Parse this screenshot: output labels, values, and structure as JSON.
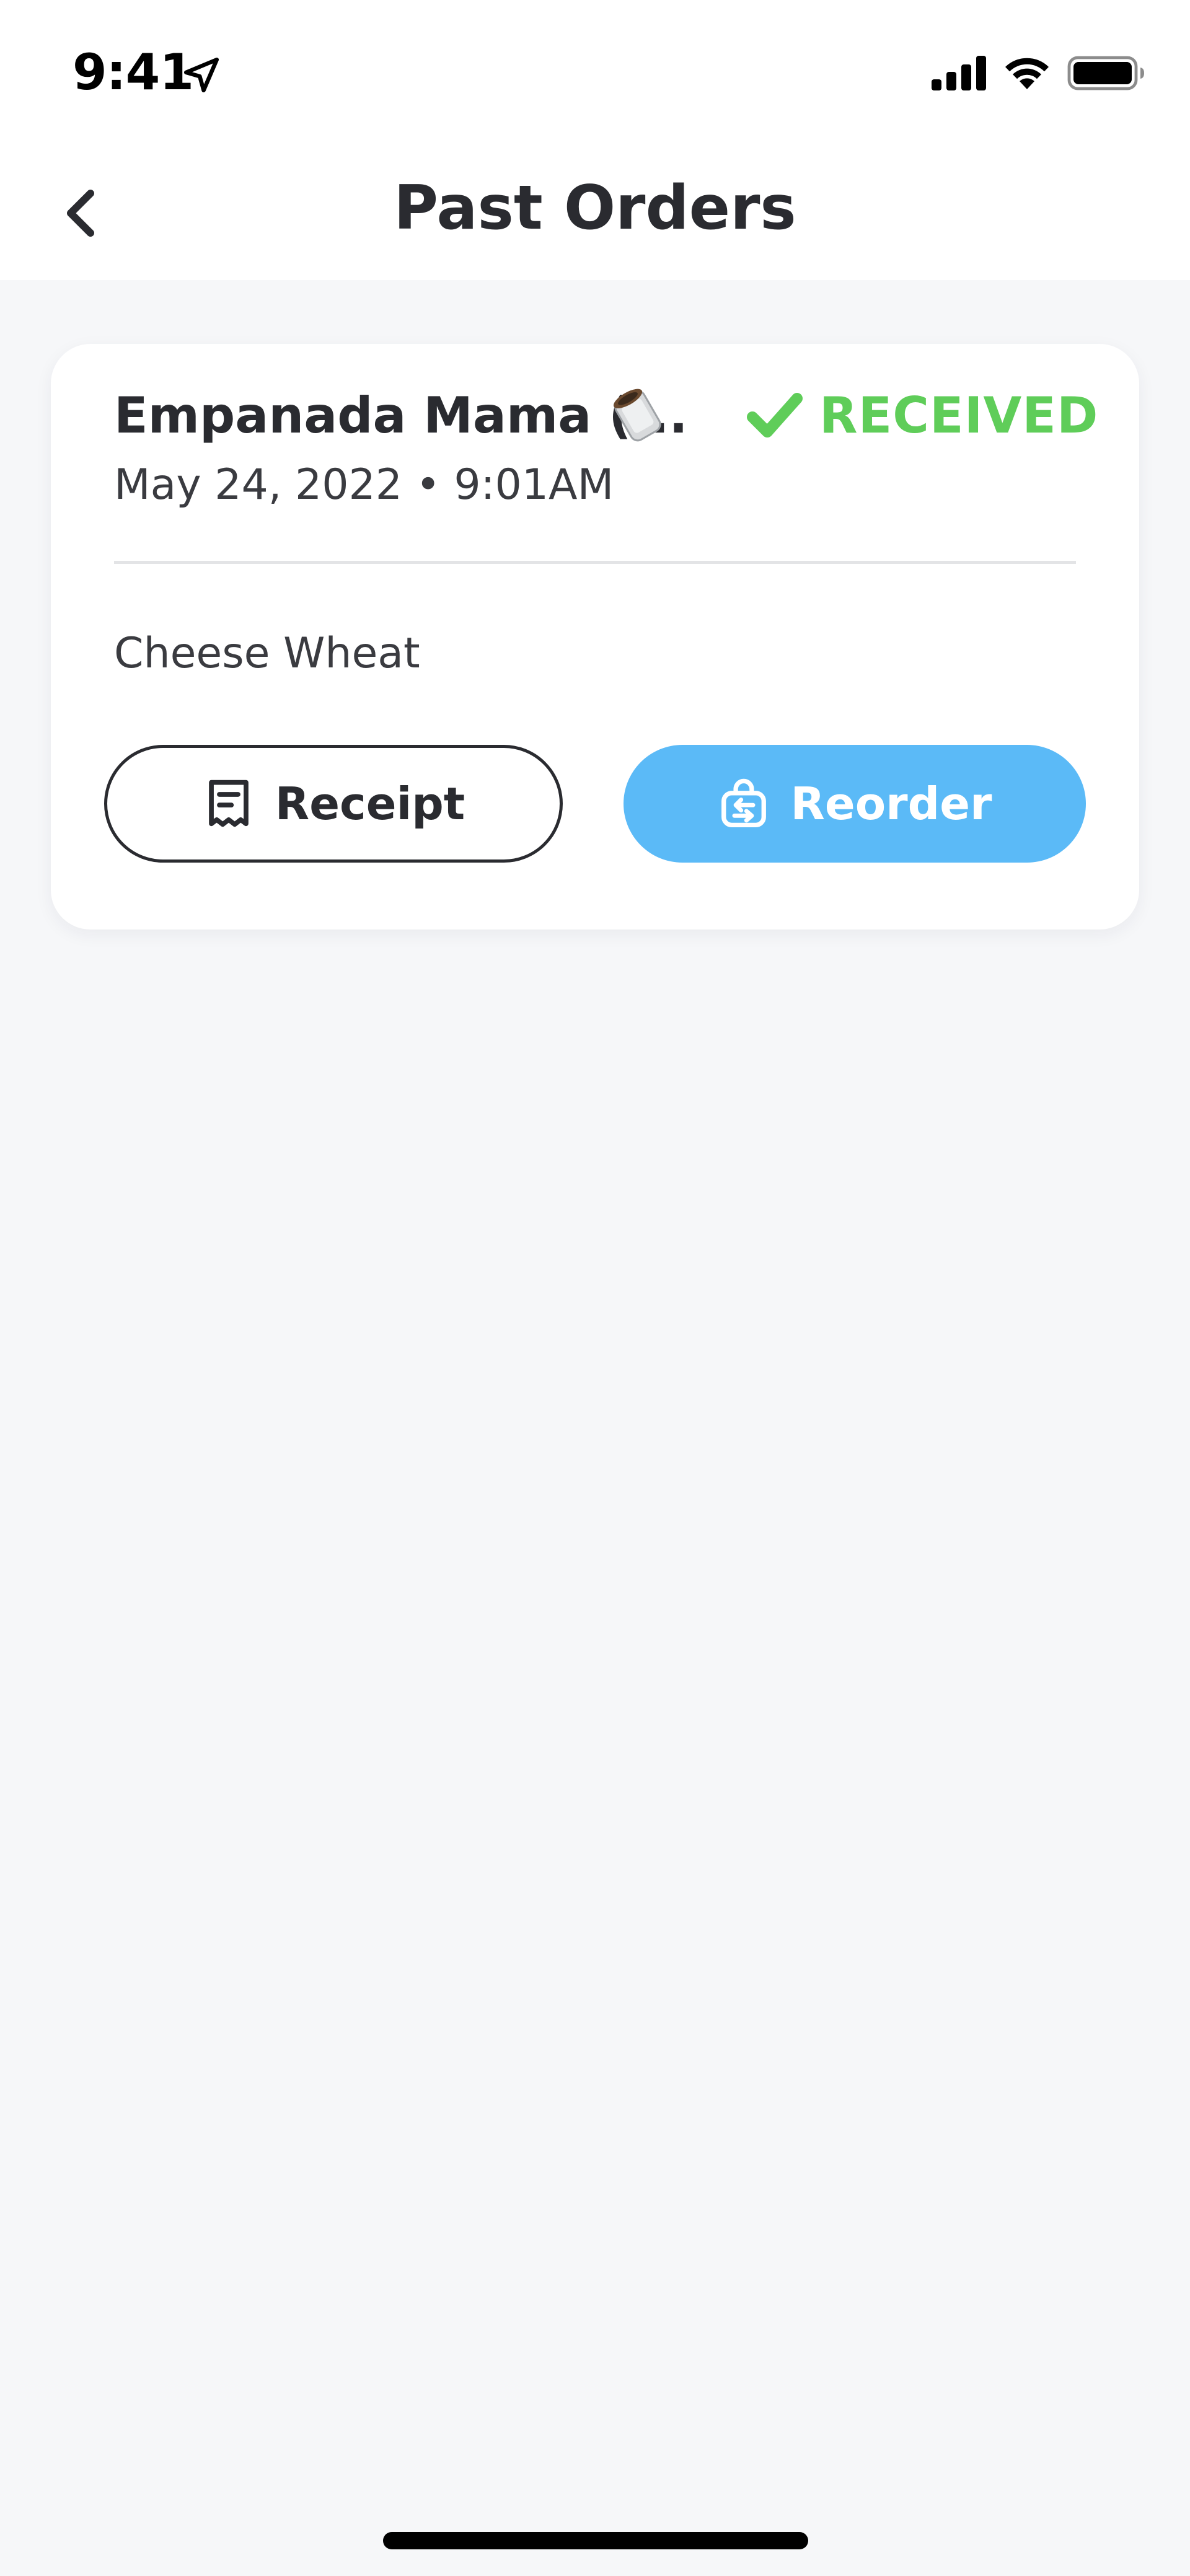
{
  "status_bar": {
    "time": "9:41",
    "icons": [
      "location-arrow-icon",
      "cellular-signal-icon",
      "wifi-icon",
      "battery-icon"
    ]
  },
  "nav": {
    "title": "Past Orders",
    "back_icon": "chevron-left-icon"
  },
  "order": {
    "restaurant": "Empanada Mama (...",
    "restaurant_icon": "food-emoji-icon",
    "status": "RECEIVED",
    "status_icon": "checkmark-icon",
    "datetime": "May 24, 2022 • 9:01AM",
    "items": "Cheese Wheat",
    "receipt_label": "Receipt",
    "receipt_icon": "receipt-icon",
    "reorder_label": "Reorder",
    "reorder_icon": "reorder-bag-icon"
  },
  "colors": {
    "accent_blue": "#5bbaf7",
    "status_green": "#5fcd59",
    "text_dark": "#2a2b30",
    "background": "#f6f7f9"
  }
}
